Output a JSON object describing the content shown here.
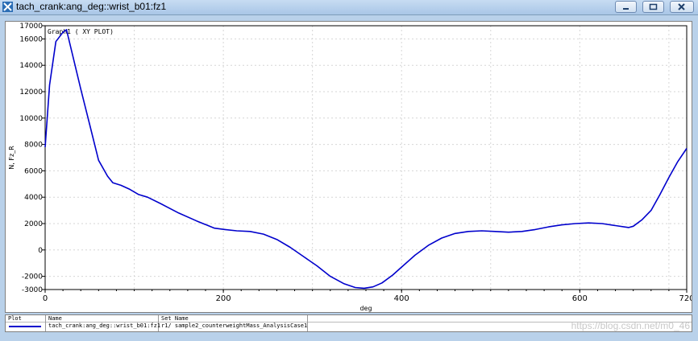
{
  "window": {
    "title": "tach_crank:ang_deg::wrist_b01:fz1"
  },
  "legend": {
    "plot_header": "Plot",
    "name_header": "Name",
    "set_header": "Set  Name",
    "name_value": "tach_crank:ang_deg::wrist_b01:fz1",
    "set_value": "r1/ sample2_counterweightMass_AnalysisCase1"
  },
  "watermark": "https://blog.csdn.net/m0_46",
  "chart_data": {
    "type": "line",
    "title": "Graph1 ( XY PLOT)",
    "xlabel": "deg",
    "ylabel": "N, Fz_R",
    "xlim": [
      0,
      720
    ],
    "ylim": [
      -3000,
      17000
    ],
    "x_ticks": [
      "0",
      "200",
      "400",
      "600",
      "720"
    ],
    "y_ticks": [
      "17000",
      "16000",
      "14000",
      "12000",
      "10000",
      "8000",
      "6000",
      "4000",
      "2000",
      "0",
      "-2000",
      "-3000"
    ],
    "grid": true,
    "series": [
      {
        "name": "tach_crank:ang_deg::wrist_b01:fz1",
        "color": "#0000cc",
        "x": [
          0,
          5,
          12,
          20,
          24,
          30,
          40,
          50,
          60,
          70,
          76,
          85,
          95,
          105,
          115,
          130,
          150,
          170,
          190,
          202,
          215,
          230,
          245,
          260,
          275,
          290,
          305,
          320,
          335,
          348,
          358,
          368,
          378,
          390,
          400,
          415,
          430,
          445,
          460,
          475,
          490,
          505,
          520,
          535,
          550,
          565,
          580,
          595,
          610,
          625,
          640,
          655,
          660,
          670,
          680,
          690,
          700,
          710,
          720
        ],
        "y": [
          7800,
          12500,
          15800,
          16500,
          16700,
          15000,
          12200,
          9500,
          6800,
          5600,
          5100,
          4900,
          4600,
          4200,
          4000,
          3500,
          2800,
          2200,
          1650,
          1550,
          1450,
          1400,
          1200,
          800,
          200,
          -500,
          -1200,
          -2000,
          -2550,
          -2850,
          -2900,
          -2800,
          -2500,
          -1900,
          -1300,
          -400,
          350,
          900,
          1250,
          1400,
          1450,
          1400,
          1350,
          1400,
          1550,
          1750,
          1900,
          2000,
          2050,
          2000,
          1850,
          1700,
          1800,
          2300,
          3000,
          4200,
          5500,
          6700,
          7700
        ]
      }
    ]
  }
}
